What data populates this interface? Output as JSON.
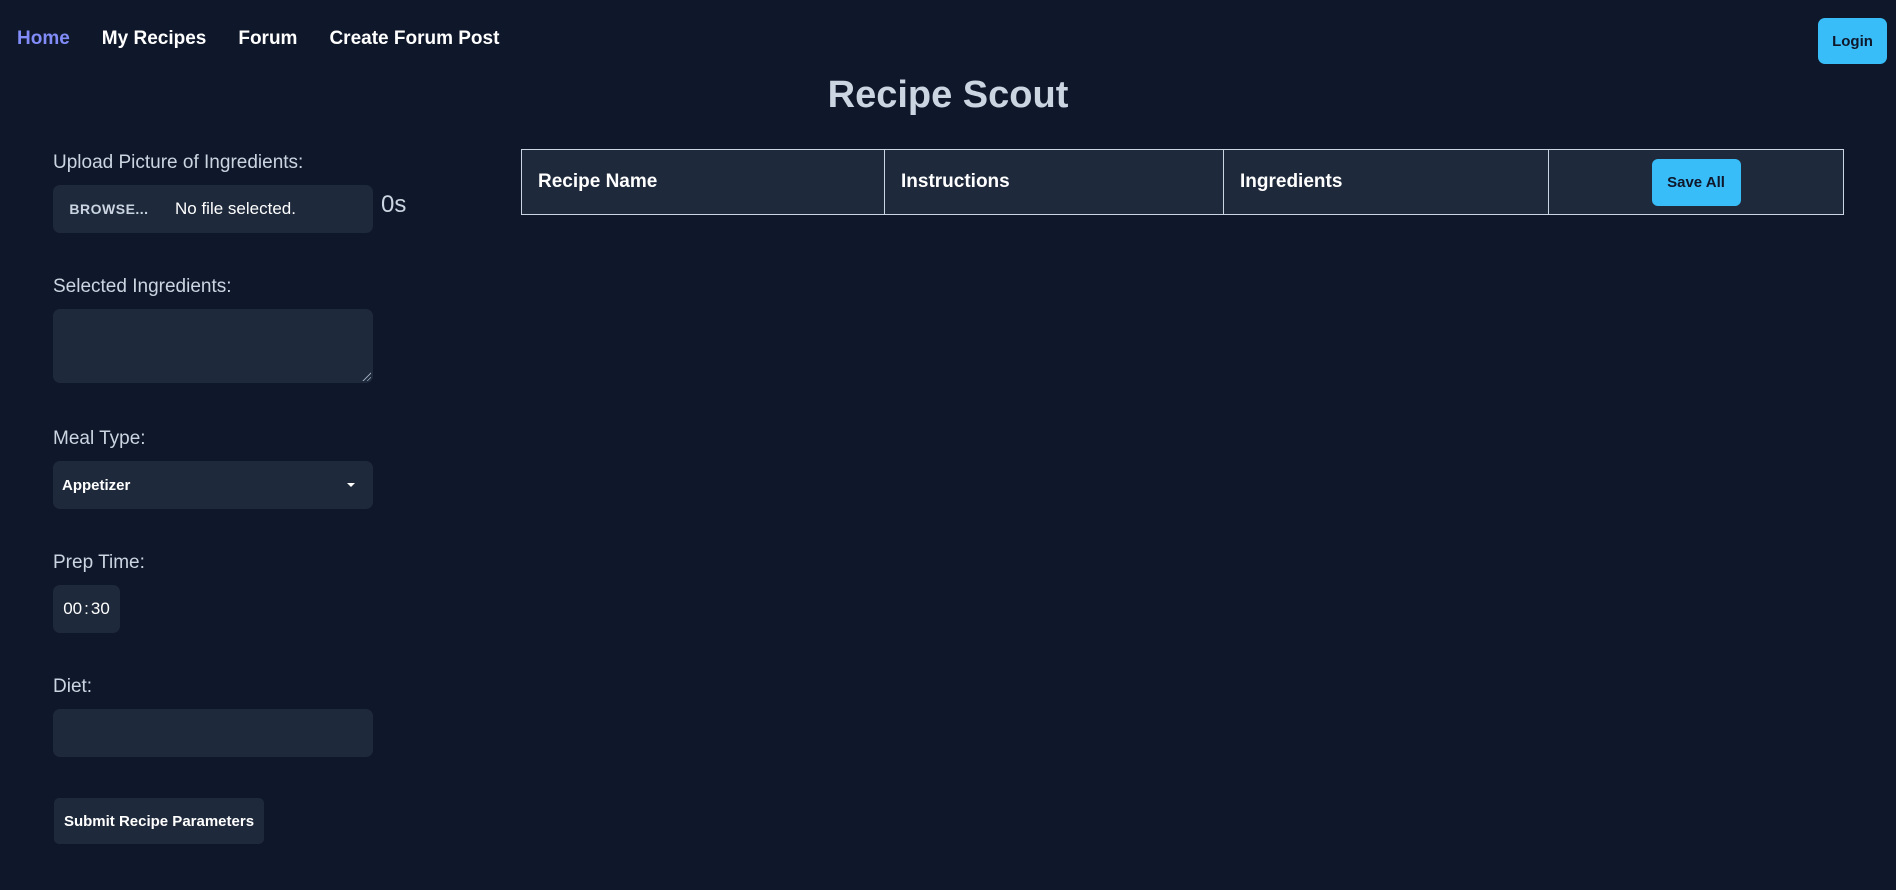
{
  "nav": {
    "items": [
      "Home",
      "My Recipes",
      "Forum",
      "Create Forum Post"
    ],
    "login": "Login"
  },
  "title": "Recipe Scout",
  "form": {
    "upload_label": "Upload Picture of Ingredients:",
    "browse": "BROWSE...",
    "no_file": "No file selected.",
    "timer": "0s",
    "ingredients_label": "Selected Ingredients:",
    "ingredients_value": "",
    "meal_label": "Meal Type:",
    "meal_value": "Appetizer",
    "prep_label": "Prep Time:",
    "prep_hours": "00",
    "prep_sep": ":",
    "prep_minutes": "30",
    "diet_label": "Diet:",
    "diet_value": "",
    "submit": "Submit Recipe Parameters"
  },
  "table": {
    "headers": [
      "Recipe Name",
      "Instructions",
      "Ingredients"
    ],
    "save_all": "Save All"
  }
}
